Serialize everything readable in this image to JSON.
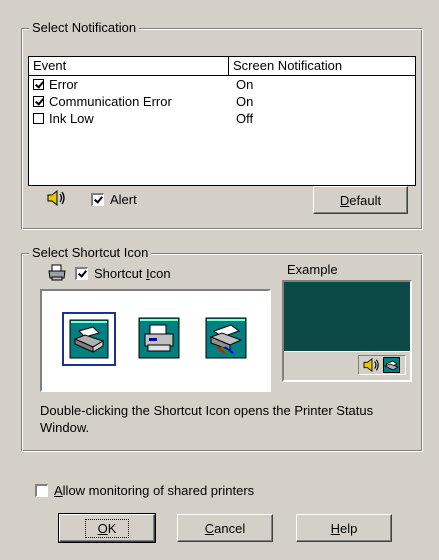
{
  "select_notification": {
    "title": "Select Notification",
    "columns": [
      "Event",
      "Screen Notification"
    ],
    "rows": [
      {
        "event": "Error",
        "checked": true,
        "notification": "On"
      },
      {
        "event": "Communication Error",
        "checked": true,
        "notification": "On"
      },
      {
        "event": "Ink Low",
        "checked": false,
        "notification": "Off"
      }
    ],
    "alert": {
      "label": "Alert",
      "checked": true
    },
    "default_button": {
      "prefix": "",
      "accel": "D",
      "rest": "efault"
    }
  },
  "select_shortcut_icon": {
    "title": "Select Shortcut Icon",
    "shortcut_checkbox": {
      "prefix": "Shortcut ",
      "accel": "I",
      "rest": "con",
      "checked": true
    },
    "example_label": "Example",
    "description": "Double-clicking the Shortcut Icon opens the Printer Status Window.",
    "icons": [
      "printer-icon-style-1",
      "printer-icon-style-2",
      "printer-icon-style-3"
    ]
  },
  "shared_printers": {
    "prefix": "",
    "accel": "A",
    "rest": "llow monitoring of shared printers",
    "checked": false
  },
  "buttons": {
    "ok": {
      "accel": "O",
      "rest": "K"
    },
    "cancel": {
      "accel": "C",
      "rest": "ancel"
    },
    "help": {
      "accel": "H",
      "rest": "elp"
    }
  },
  "colors": {
    "dialog_bg": "#d4d0c8",
    "example_bg": "#0b4a47"
  }
}
